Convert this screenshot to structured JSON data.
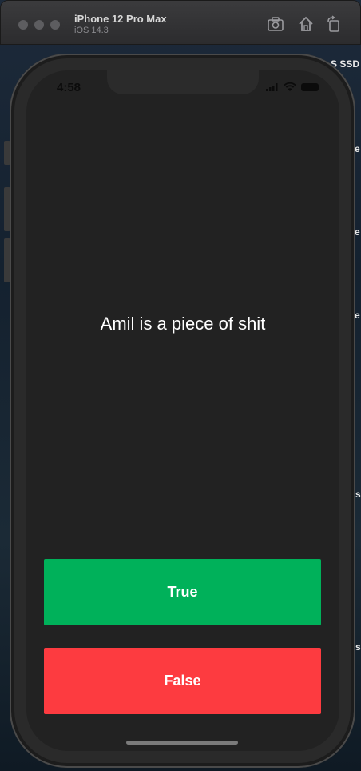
{
  "window": {
    "title": "iPhone 12 Pro Max",
    "subtitle": "iOS 14.3",
    "toolbar_icons": [
      "screenshot-icon",
      "home-icon",
      "rotate-icon"
    ]
  },
  "desktop": {
    "fragments": [
      "S SSD",
      "e",
      "e",
      "e",
      "s",
      "s"
    ]
  },
  "status_bar": {
    "time": "4:58",
    "icons": [
      "signal-icon",
      "wifi-icon",
      "battery-icon"
    ]
  },
  "quiz": {
    "question": "Amil is a piece of shit",
    "true_label": "True",
    "false_label": "False"
  },
  "colors": {
    "background": "#222222",
    "true_button": "#00b15a",
    "false_button": "#fd3b40",
    "text": "#ffffff"
  }
}
